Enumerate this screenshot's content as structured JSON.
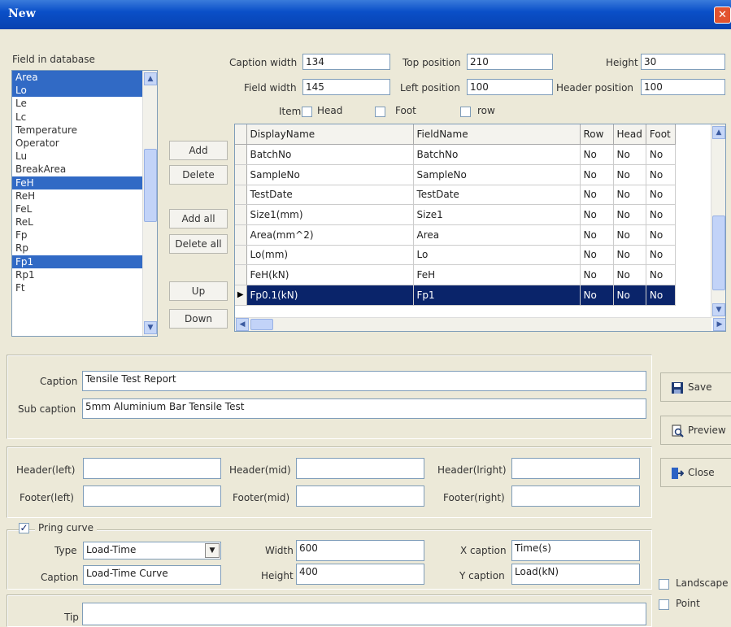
{
  "window": {
    "title": "New",
    "close_glyph": "✕"
  },
  "field_list": {
    "label": "Field in database",
    "items": [
      {
        "label": "Area",
        "selected": true
      },
      {
        "label": "Lo",
        "selected": true
      },
      {
        "label": "Le",
        "selected": false
      },
      {
        "label": "Lc",
        "selected": false
      },
      {
        "label": "Temperature",
        "selected": false
      },
      {
        "label": "Operator",
        "selected": false
      },
      {
        "label": "Lu",
        "selected": false
      },
      {
        "label": "BreakArea",
        "selected": false
      },
      {
        "label": "FeH",
        "selected": true
      },
      {
        "label": "ReH",
        "selected": false
      },
      {
        "label": "FeL",
        "selected": false
      },
      {
        "label": "ReL",
        "selected": false
      },
      {
        "label": "Fp",
        "selected": false
      },
      {
        "label": "Rp",
        "selected": false
      },
      {
        "label": "Fp1",
        "selected": true
      },
      {
        "label": "Rp1",
        "selected": false
      },
      {
        "label": "Ft",
        "selected": false
      }
    ]
  },
  "layout_fields": {
    "caption_width_label": "Caption width",
    "caption_width": "134",
    "field_width_label": "Field width",
    "field_width": "145",
    "top_position_label": "Top position",
    "top_position": "210",
    "left_position_label": "Left position",
    "left_position": "100",
    "height_label": "Height",
    "height": "30",
    "header_position_label": "Header position",
    "header_position": "100"
  },
  "item_options": {
    "item_label": "Item",
    "head_label": "Head",
    "foot_label": "Foot",
    "row_label": "row",
    "head_checked": false,
    "foot_checked": false,
    "row_checked": false
  },
  "action_buttons": {
    "add": "Add",
    "delete": "Delete",
    "add_all": "Add all",
    "delete_all": "Delete all",
    "up": "Up",
    "down": "Down"
  },
  "grid": {
    "columns": [
      "DisplayName",
      "FieldName",
      "Row",
      "Head",
      "Foot"
    ],
    "rows": [
      {
        "display": "BatchNo",
        "field": "BatchNo",
        "row": "No",
        "head": "No",
        "foot": "No",
        "current": false
      },
      {
        "display": "SampleNo",
        "field": "SampleNo",
        "row": "No",
        "head": "No",
        "foot": "No",
        "current": false
      },
      {
        "display": "TestDate",
        "field": "TestDate",
        "row": "No",
        "head": "No",
        "foot": "No",
        "current": false
      },
      {
        "display": "Size1(mm)",
        "field": "Size1",
        "row": "No",
        "head": "No",
        "foot": "No",
        "current": false
      },
      {
        "display": "Area(mm^2)",
        "field": "Area",
        "row": "No",
        "head": "No",
        "foot": "No",
        "current": false
      },
      {
        "display": "Lo(mm)",
        "field": "Lo",
        "row": "No",
        "head": "No",
        "foot": "No",
        "current": false
      },
      {
        "display": "FeH(kN)",
        "field": "FeH",
        "row": "No",
        "head": "No",
        "foot": "No",
        "current": false
      },
      {
        "display": "Fp0.1(kN)",
        "field": "Fp1",
        "row": "No",
        "head": "No",
        "foot": "No",
        "current": true
      }
    ]
  },
  "captions": {
    "caption_label": "Caption",
    "caption": "Tensile Test Report",
    "sub_caption_label": "Sub caption",
    "sub_caption": "5mm Aluminium Bar Tensile Test"
  },
  "header_footer": {
    "header_left_label": "Header(left)",
    "header_left": "",
    "header_mid_label": "Header(mid)",
    "header_mid": "",
    "header_right_label": "Header(lright)",
    "header_right": "",
    "footer_left_label": "Footer(left)",
    "footer_left": "",
    "footer_mid_label": "Footer(mid)",
    "footer_mid": "",
    "footer_right_label": "Footer(right)",
    "footer_right": ""
  },
  "curve": {
    "print_label": "Pring curve",
    "print_checked": true,
    "type_label": "Type",
    "type": "Load-Time",
    "caption_label": "Caption",
    "caption": "Load-Time Curve",
    "width_label": "Width",
    "width": "600",
    "height_label": "Height",
    "height": "400",
    "x_caption_label": "X caption",
    "x_caption": "Time(s)",
    "y_caption_label": "Y caption",
    "y_caption": "Load(kN)"
  },
  "tip": {
    "label": "Tip",
    "value": ""
  },
  "side_buttons": {
    "save": "Save",
    "preview": "Preview",
    "close": "Close"
  },
  "options": {
    "landscape": "Landscape",
    "landscape_checked": false,
    "point": "Point",
    "point_checked": false
  }
}
